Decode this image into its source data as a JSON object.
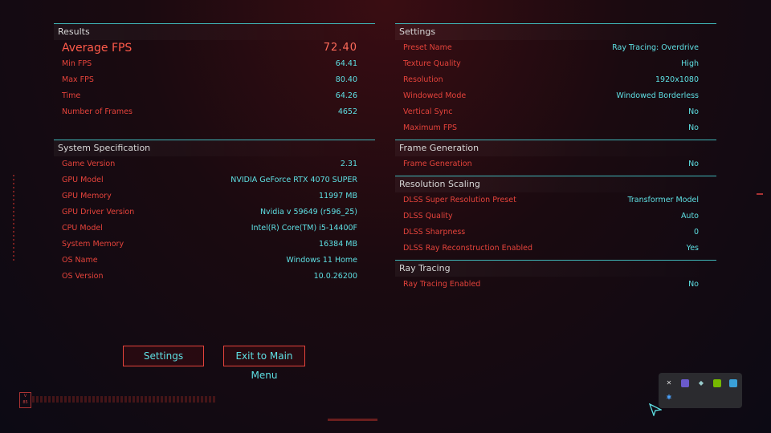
{
  "results": {
    "title": "Results",
    "avg_label": "Average FPS",
    "avg_value": "72.40",
    "rows": [
      {
        "label": "Min FPS",
        "value": "64.41"
      },
      {
        "label": "Max FPS",
        "value": "80.40"
      },
      {
        "label": "Time",
        "value": "64.26"
      },
      {
        "label": "Number of Frames",
        "value": "4652"
      }
    ]
  },
  "system": {
    "title": "System Specification",
    "rows": [
      {
        "label": "Game Version",
        "value": "2.31"
      },
      {
        "label": "GPU Model",
        "value": "NVIDIA GeForce RTX 4070 SUPER"
      },
      {
        "label": "GPU Memory",
        "value": "11997 MB"
      },
      {
        "label": "GPU Driver Version",
        "value": "Nvidia v 59649 (r596_25)"
      },
      {
        "label": "CPU Model",
        "value": "Intel(R) Core(TM) i5-14400F"
      },
      {
        "label": "System Memory",
        "value": "16384 MB"
      },
      {
        "label": "OS Name",
        "value": "Windows 11 Home"
      },
      {
        "label": "OS Version",
        "value": "10.0.26200"
      }
    ]
  },
  "settings": {
    "title": "Settings",
    "rows": [
      {
        "label": "Preset Name",
        "value": "Ray Tracing: Overdrive"
      },
      {
        "label": "Texture Quality",
        "value": "High"
      },
      {
        "label": "Resolution",
        "value": "1920x1080"
      },
      {
        "label": "Windowed Mode",
        "value": "Windowed Borderless"
      },
      {
        "label": "Vertical Sync",
        "value": "No"
      },
      {
        "label": "Maximum FPS",
        "value": "No"
      }
    ]
  },
  "frame_gen": {
    "title": "Frame Generation",
    "rows": [
      {
        "label": "Frame Generation",
        "value": "No"
      }
    ]
  },
  "res_scaling": {
    "title": "Resolution Scaling",
    "rows": [
      {
        "label": "DLSS Super Resolution Preset",
        "value": "Transformer Model"
      },
      {
        "label": "DLSS Quality",
        "value": "Auto"
      },
      {
        "label": "DLSS Sharpness",
        "value": "0"
      },
      {
        "label": "DLSS Ray Reconstruction Enabled",
        "value": "Yes"
      }
    ]
  },
  "ray_tracing": {
    "title": "Ray Tracing",
    "rows": [
      {
        "label": "Ray Tracing Enabled",
        "value": "No"
      }
    ]
  },
  "buttons": {
    "settings": "Settings",
    "exit": "Exit to Main Menu"
  },
  "colors": {
    "label_red": "#e5433b",
    "value_cyan": "#5ee0e4",
    "divider_teal": "#3fb6b8"
  },
  "tray_icons": [
    "cursor-icon",
    "monitor-icon",
    "steam-icon",
    "nvidia-icon",
    "app-icon",
    "bluetooth-icon"
  ]
}
